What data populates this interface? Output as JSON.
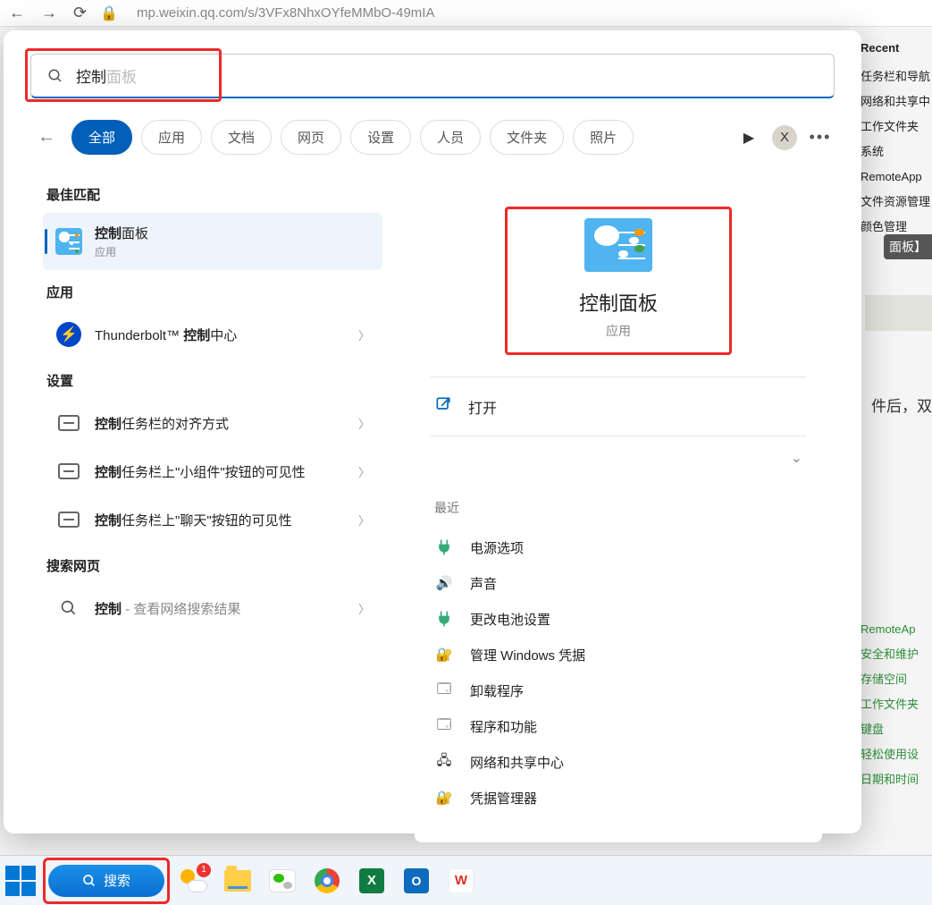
{
  "browser": {
    "url": "mp.weixin.qq.com/s/3VFx8NhxOYfeMMbO-49mIA"
  },
  "bg_right": {
    "header": "Recent",
    "items": [
      "任务栏和导航",
      "网络和共享中",
      "工作文件夹",
      "系统",
      "RemoteApp",
      "文件资源管理",
      "颜色管理"
    ],
    "pill": "面板】",
    "fragment": "件后，双"
  },
  "bg_right_lower": {
    "items": [
      "RemoteAp",
      "安全和维护",
      "存储空间",
      "工作文件夹",
      "键盘",
      "轻松使用设",
      "日期和时间"
    ]
  },
  "search": {
    "typed": "控制",
    "ghost": "面板"
  },
  "tabs": {
    "items": [
      "全部",
      "应用",
      "文档",
      "网页",
      "设置",
      "人员",
      "文件夹",
      "照片"
    ],
    "avatar": "X"
  },
  "left": {
    "best_match": "最佳匹配",
    "best": {
      "title_bold": "控制",
      "title_rest": "面板",
      "sub": "应用"
    },
    "apps_header": "应用",
    "app1": {
      "pre": "Thunderbolt™ ",
      "bold": "控制",
      "post": "中心"
    },
    "settings_header": "设置",
    "s1": {
      "bold": "控制",
      "rest": "任务栏的对齐方式"
    },
    "s2": {
      "bold": "控制",
      "rest": "任务栏上\"小组件\"按钮的可见性"
    },
    "s3": {
      "bold": "控制",
      "rest": "任务栏上\"聊天\"按钮的可见性"
    },
    "web_header": "搜索网页",
    "web": {
      "bold": "控制",
      "suffix": " - 查看网络搜索结果"
    }
  },
  "preview": {
    "title": "控制面板",
    "sub": "应用",
    "open": "打开",
    "recent_header": "最近",
    "recent": [
      "电源选项",
      "声音",
      "更改电池设置",
      "管理 Windows 凭据",
      "卸载程序",
      "程序和功能",
      "网络和共享中心",
      "凭据管理器"
    ]
  },
  "taskbar": {
    "search": "搜索",
    "badge": "1",
    "excel": "X",
    "outlook": "O",
    "wps": "W"
  }
}
